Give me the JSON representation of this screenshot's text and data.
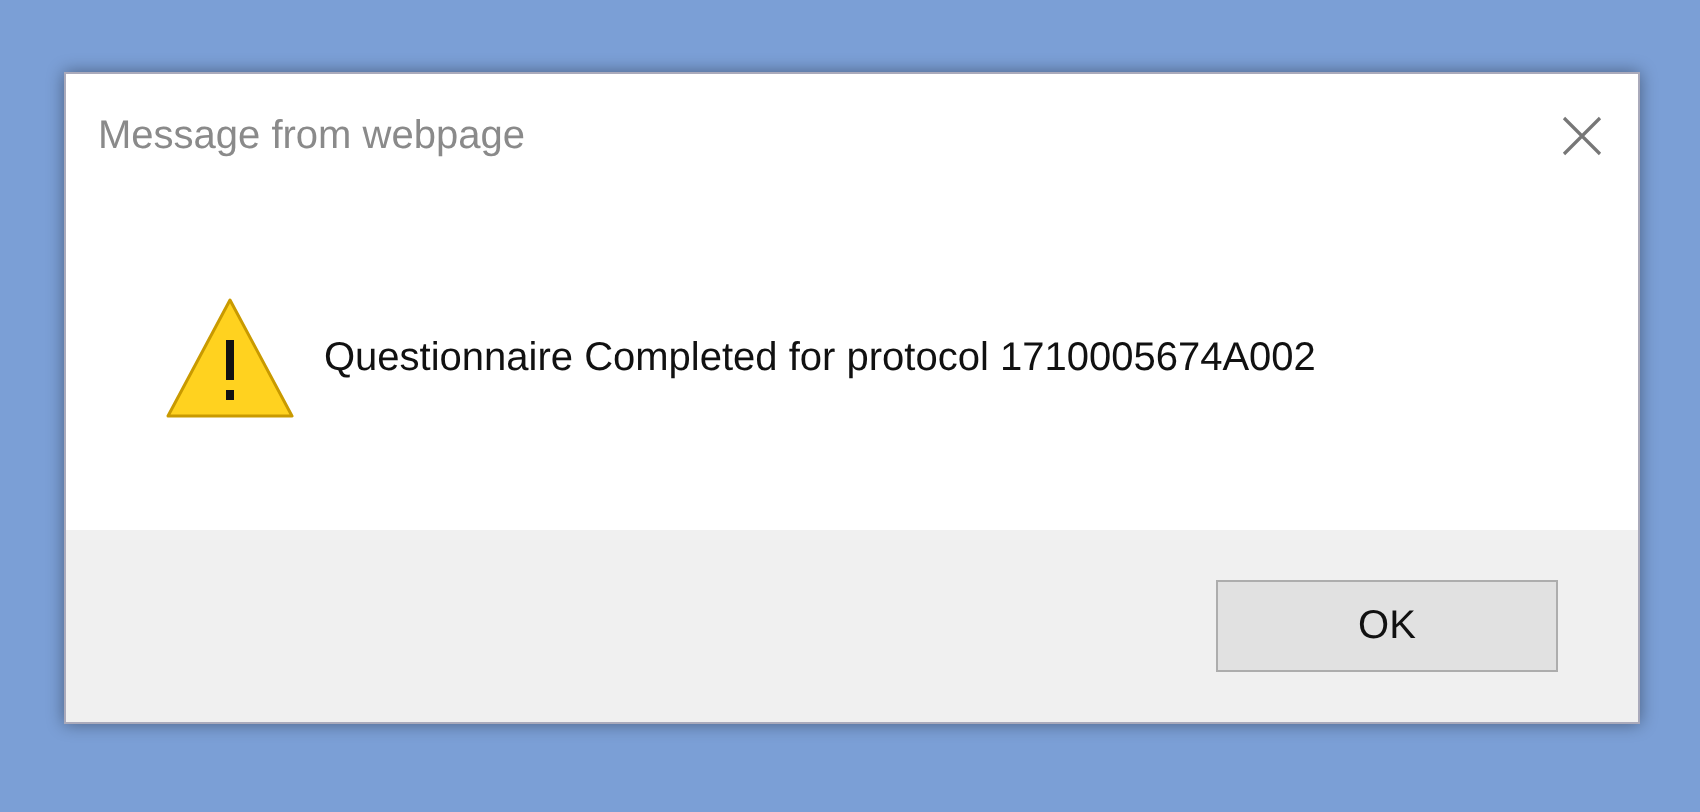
{
  "window": {
    "title": "Message from webpage"
  },
  "message": "Questionnaire Completed for protocol 1710005674A002",
  "buttons": [
    "OK"
  ]
}
